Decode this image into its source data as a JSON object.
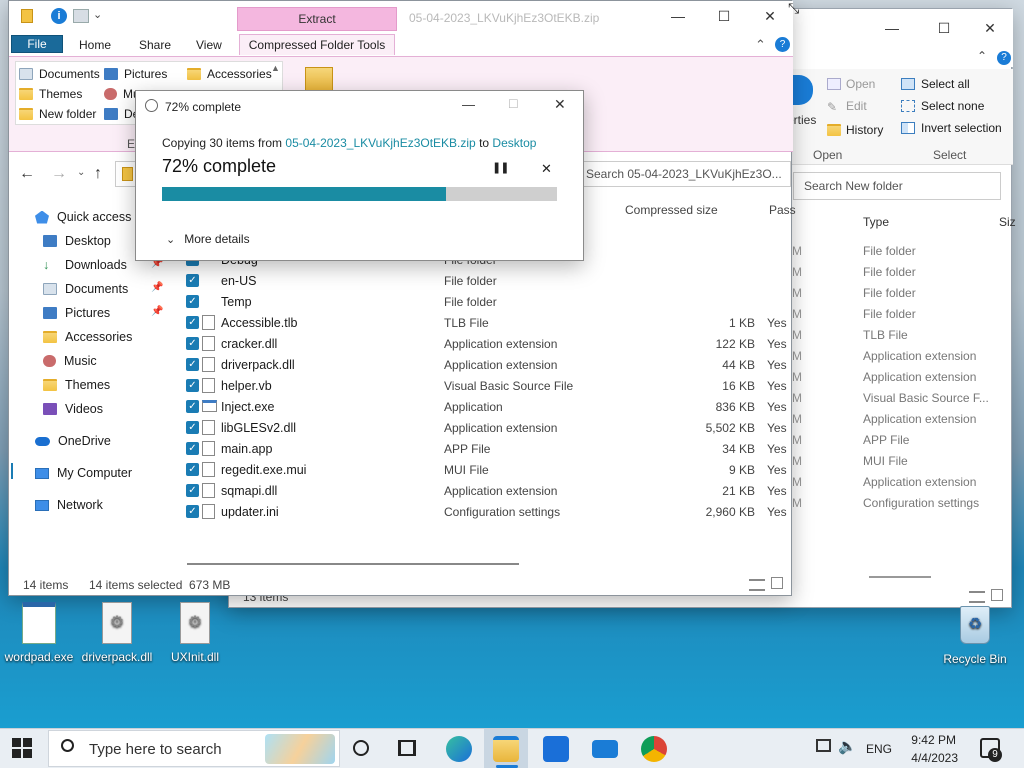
{
  "colors": {
    "accent": "#1a8ca3",
    "ribbon_pink": "#fbeef7",
    "extract_tab": "#f4b7df",
    "selection_blue": "#1a7cb4"
  },
  "bg_window": {
    "ribbon": {
      "open_label": "Open",
      "edit_label": "Edit",
      "history_label": "History",
      "properties_fragment": "erties",
      "select_all": "Select all",
      "select_none": "Select none",
      "invert_selection": "Invert selection",
      "group_open": "Open",
      "group_select": "Select"
    },
    "search_placeholder": "Search New folder",
    "columns": {
      "type": "Type",
      "size_fragment": "Siz"
    },
    "types": [
      "File folder",
      "File folder",
      "File folder",
      "File folder",
      "TLB File",
      "Application extension",
      "Application extension",
      "Visual Basic Source F...",
      "Application extension",
      "APP File",
      "MUI File",
      "Application extension",
      "Configuration settings"
    ],
    "m_fragments": [
      "M",
      "M",
      "M",
      "M",
      "M",
      "M",
      "M",
      "M",
      "M",
      "M",
      "M",
      "M",
      "M"
    ],
    "status_items": "13 items"
  },
  "main_window": {
    "title": "05-04-2023_LKVuKjhEz3OtEKB.zip",
    "extract_tab": "Extract",
    "tabs": {
      "file": "File",
      "home": "Home",
      "share": "Share",
      "view": "View",
      "tools": "Compressed Folder Tools"
    },
    "ribbon_items": [
      "Documents",
      "Pictures",
      "Accessories",
      "Themes",
      "Mu",
      "New folder",
      "De"
    ],
    "ribbon_group_fragment": "Ex",
    "search_text": "Search 05-04-2023_LKVuKjhEz3O...",
    "columns": {
      "compressed": "Compressed size",
      "pass_fragment": "Pass"
    },
    "nav": {
      "quick_access": "Quick access",
      "items": [
        "Desktop",
        "Downloads",
        "Documents",
        "Pictures",
        "Accessories",
        "Music",
        "Themes",
        "Videos"
      ],
      "onedrive": "OneDrive",
      "mycomputer": "My Computer",
      "network": "Network"
    },
    "files": [
      {
        "name": "Debug",
        "type": "File folder",
        "size": "",
        "pass": ""
      },
      {
        "name": "en-US",
        "type": "File folder",
        "size": "",
        "pass": ""
      },
      {
        "name": "Temp",
        "type": "File folder",
        "size": "",
        "pass": ""
      },
      {
        "name": "Accessible.tlb",
        "type": "TLB File",
        "size": "1 KB",
        "pass": "Yes"
      },
      {
        "name": "cracker.dll",
        "type": "Application extension",
        "size": "122 KB",
        "pass": "Yes"
      },
      {
        "name": "driverpack.dll",
        "type": "Application extension",
        "size": "44 KB",
        "pass": "Yes"
      },
      {
        "name": "helper.vb",
        "type": "Visual Basic Source File",
        "size": "16 KB",
        "pass": "Yes"
      },
      {
        "name": "Inject.exe",
        "type": "Application",
        "size": "836 KB",
        "pass": "Yes"
      },
      {
        "name": "libGLESv2.dll",
        "type": "Application extension",
        "size": "5,502 KB",
        "pass": "Yes"
      },
      {
        "name": "main.app",
        "type": "APP File",
        "size": "34 KB",
        "pass": "Yes"
      },
      {
        "name": "regedit.exe.mui",
        "type": "MUI File",
        "size": "9 KB",
        "pass": "Yes"
      },
      {
        "name": "sqmapi.dll",
        "type": "Application extension",
        "size": "21 KB",
        "pass": "Yes"
      },
      {
        "name": "updater.ini",
        "type": "Configuration settings",
        "size": "2,960 KB",
        "pass": "Yes"
      }
    ],
    "status": {
      "items": "14 items",
      "selected": "14 items selected  673 MB"
    }
  },
  "dialog": {
    "title": "72% complete",
    "copy_prefix": "Copying 30 items from ",
    "copy_source": "05-04-2023_LKVuKjhEz3OtEKB.zip",
    "copy_to": " to ",
    "copy_dest": "Desktop",
    "heading": "72% complete",
    "progress_fraction": 0.72,
    "more_details": "More details"
  },
  "desktop_icons": [
    {
      "label": "wordpad.exe",
      "icon": "wordpad-icon"
    },
    {
      "label": "driverpack.dll",
      "icon": "gear-file-icon"
    },
    {
      "label": "UXInit.dll",
      "icon": "gear-file-icon"
    },
    {
      "label": "Recycle Bin",
      "icon": "recycle-bin-icon"
    }
  ],
  "taskbar": {
    "search_placeholder": "Type here to search",
    "language": "ENG",
    "time": "9:42 PM",
    "date": "4/4/2023",
    "notification_count": "9"
  }
}
